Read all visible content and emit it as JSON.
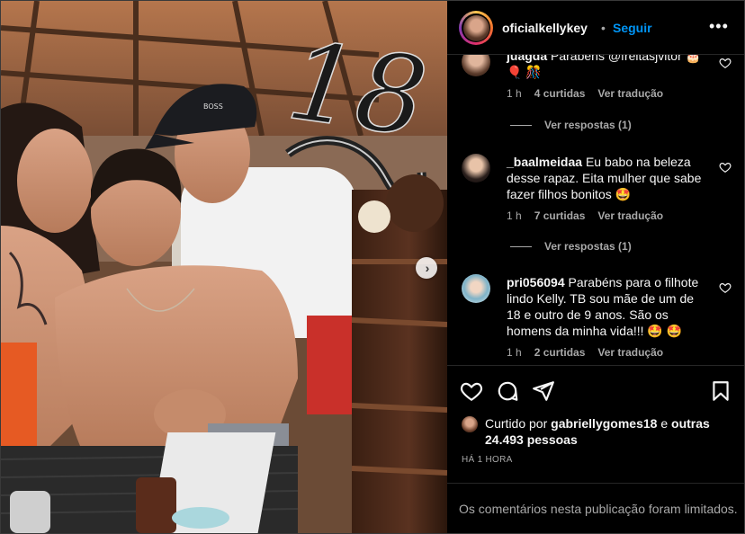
{
  "post": {
    "username": "oficialkellykey",
    "follow_label": "Seguir",
    "dot": "•",
    "more_label": "•••"
  },
  "photo": {
    "alt": "Post photo",
    "cake_topper_text": "18"
  },
  "comments": [
    {
      "username": "juagda",
      "text": "Parabéns @freitasjvitor 🎂 🎈 🎊",
      "time": "1 h",
      "likes": "4 curtidas",
      "translate": "Ver tradução",
      "replies": "Ver respostas (1)"
    },
    {
      "username": "_baalmeidaa",
      "text": "Eu babo na beleza desse rapaz. Eita mulher que sabe fazer filhos bonitos 🤩",
      "time": "1 h",
      "likes": "7 curtidas",
      "translate": "Ver tradução",
      "replies": "Ver respostas (1)"
    },
    {
      "username": "pri056094",
      "text": "Parabéns para o filhote lindo Kelly. TB sou mãe de um de 18 e outro de 9 anos. São os homens da minha vida!!! 🤩 🤩",
      "time": "1 h",
      "likes": "2 curtidas",
      "translate": "Ver tradução"
    }
  ],
  "liked_by": {
    "prefix": "Curtido por",
    "user": "gabriellygomes18",
    "connector": "e",
    "others": "outras 24.493 pessoas"
  },
  "timestamp": "HÁ 1 HORA",
  "comments_limited": "Os comentários nesta publicação foram limitados.",
  "icons": {
    "like": "heart-icon",
    "comment": "comment-icon",
    "share": "share-icon",
    "save": "bookmark-icon",
    "next": "chevron-right-icon",
    "more": "more-options-icon"
  },
  "colors": {
    "follow_blue": "#0095f6",
    "muted_text": "#a8a8a8",
    "background": "#000000"
  }
}
